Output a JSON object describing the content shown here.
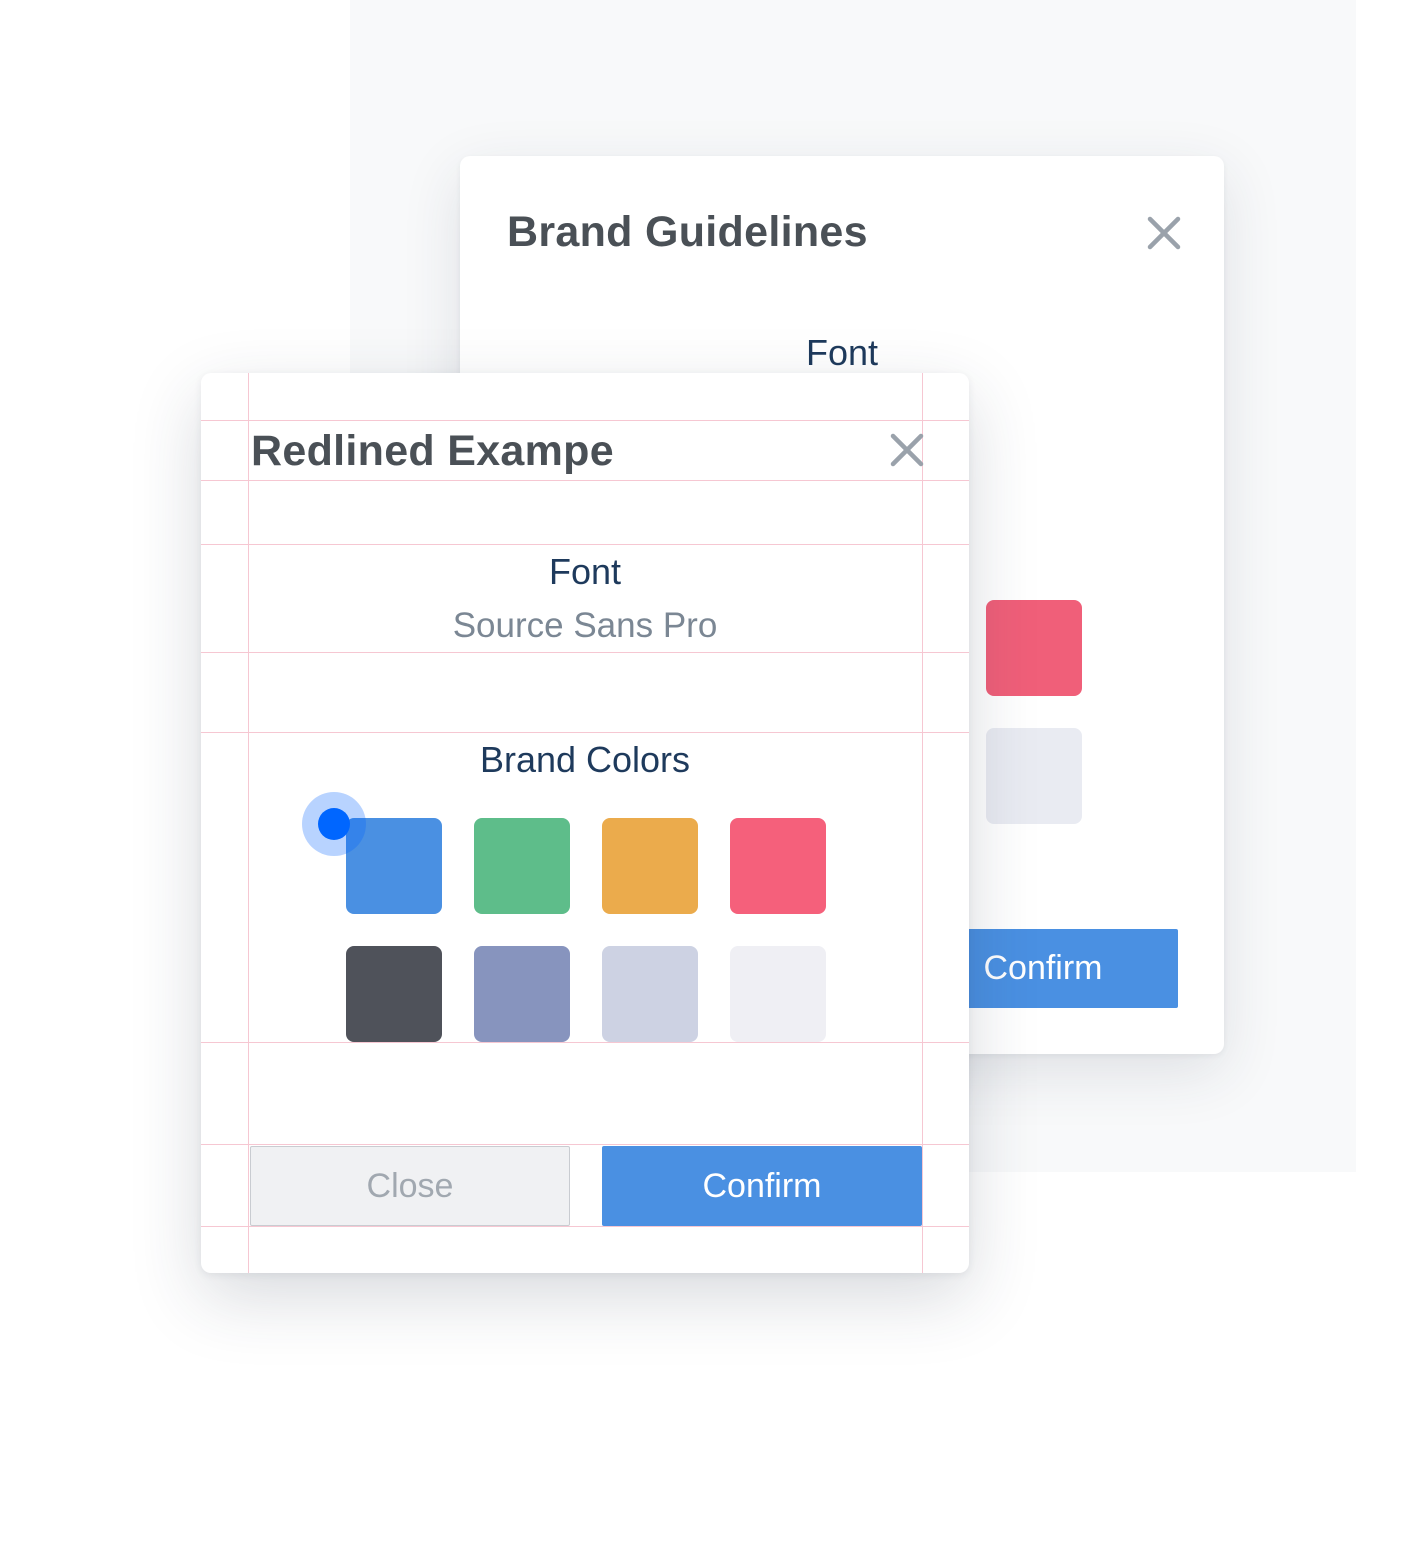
{
  "back_dialog": {
    "title": "Brand Guidelines",
    "close_icon": "close-icon",
    "font_label": "Font",
    "swatches": [
      {
        "color": "#f05f79"
      },
      {
        "color": "#e9ebf2"
      }
    ],
    "confirm_label": "Confirm"
  },
  "front_dialog": {
    "title": "Redlined Exampe",
    "close_icon": "close-icon",
    "font_label": "Font",
    "font_value": "Source Sans Pro",
    "colors_label": "Brand Colors",
    "swatches": [
      {
        "color": "#4a90e2"
      },
      {
        "color": "#5ebd8a"
      },
      {
        "color": "#ebab4c"
      },
      {
        "color": "#f5607b"
      },
      {
        "color": "#4f525a"
      },
      {
        "color": "#8794be"
      },
      {
        "color": "#cdd2e3"
      },
      {
        "color": "#efeff4"
      }
    ],
    "close_button_label": "Close",
    "confirm_button_label": "Confirm"
  },
  "colors": {
    "accent": "#4a90e2",
    "redline": "#f6c7d2",
    "heading": "#4a5056",
    "label": "#1e3a5c",
    "muted": "#7b8794",
    "cursor": "#0066ff"
  }
}
